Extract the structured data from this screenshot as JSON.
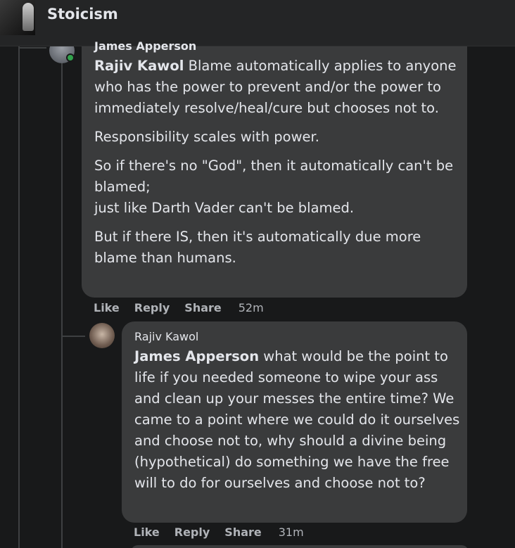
{
  "header": {
    "group_name": "Stoicism",
    "thumb_icon": "group-cover-image"
  },
  "comments": [
    {
      "author": "James Apperson",
      "mention": "Rajiv Kawol",
      "paragraphs": [
        " Blame automatically applies to anyone who has the power to prevent and/or the power to immediately resolve/heal/cure but chooses not to.",
        "Responsibility scales with power.",
        "So if there's no \"God\", then it automatically can't be blamed;",
        "just like Darth Vader can't be blamed.",
        "But if there IS, then it's automatically due more blame than humans."
      ],
      "actions": {
        "like": "Like",
        "reply": "Reply",
        "share": "Share",
        "time": "52m"
      },
      "online": true
    },
    {
      "author": "Rajiv Kawol",
      "mention": "James Apperson",
      "body": " what would be the point to life if you needed someone to wipe your ass and clean up your messes the entire time? We came to a point where we could do it ourselves and choose not to, why should a divine being (hypothetical) do something we have the free will to do for ourselves and choose not to?",
      "actions": {
        "like": "Like",
        "reply": "Reply",
        "share": "Share",
        "time": "31m"
      }
    }
  ],
  "colors": {
    "background": "#18191a",
    "bubble": "#3a3b3c",
    "text": "#e4e6eb",
    "secondary_text": "#b0b3b8",
    "online": "#31a24c"
  }
}
